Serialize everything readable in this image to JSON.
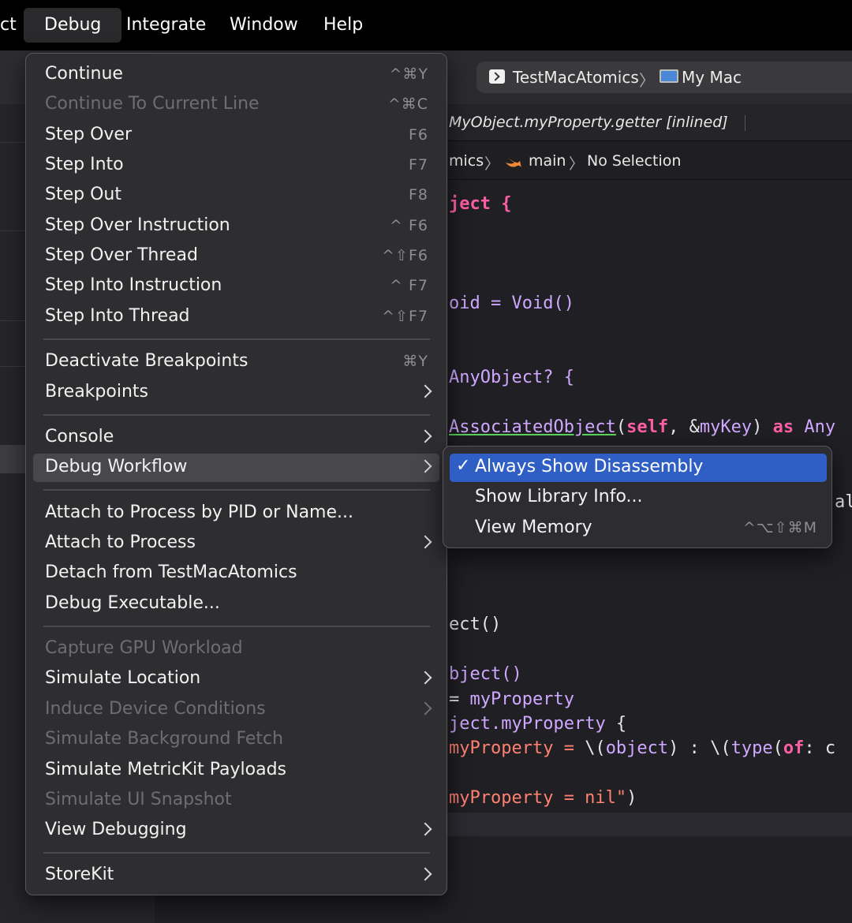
{
  "menubar": {
    "items": [
      "ct",
      "Debug",
      "Integrate",
      "Window",
      "Help"
    ],
    "active_index": 1
  },
  "toolbar": {
    "scheme": "TestMacAtomics",
    "destination": "My Mac"
  },
  "debug_bar": {
    "stack_frame": "MyObject.myProperty.getter [inlined]"
  },
  "jump_bar": {
    "file_fragment": "mics",
    "symbol": "main",
    "selection": "No Selection"
  },
  "code_lines": [
    [
      "ject {"
    ],
    [
      "oid = Void()"
    ],
    [
      "AnyObject? {"
    ],
    [
      "AssociatedObject",
      "(",
      "self",
      ", &",
      "myKey",
      ") ",
      "as",
      " Any"
    ],
    [
      "al"
    ],
    [
      "ect()"
    ],
    [
      "bject()"
    ],
    [
      "= ",
      "myProperty"
    ],
    [
      "ject.",
      "myProperty",
      " {"
    ],
    [
      "myProperty = ",
      "\\(",
      "object",
      ") : \\(",
      "type",
      "(",
      "of",
      ": c"
    ],
    [
      "myProperty = nil\"",
      ")"
    ]
  ],
  "debug_menu": {
    "items": [
      {
        "label": "Continue",
        "shortcut": "^⌘Y"
      },
      {
        "label": "Continue To Current Line",
        "shortcut": "^⌘C"
      },
      {
        "label": "Step Over",
        "shortcut": "F6"
      },
      {
        "label": "Step Into",
        "shortcut": "F7"
      },
      {
        "label": "Step Out",
        "shortcut": "F8"
      },
      {
        "label": "Step Over Instruction",
        "shortcut": "^ F6"
      },
      {
        "label": "Step Over Thread",
        "shortcut": "^⇧F6"
      },
      {
        "label": "Step Into Instruction",
        "shortcut": "^ F7"
      },
      {
        "label": "Step Into Thread",
        "shortcut": "^⇧F7"
      },
      {
        "label": "Deactivate Breakpoints",
        "shortcut": "⌘Y"
      },
      {
        "label": "Breakpoints"
      },
      {
        "label": "Console"
      },
      {
        "label": "Debug Workflow"
      },
      {
        "label": "Attach to Process by PID or Name..."
      },
      {
        "label": "Attach to Process"
      },
      {
        "label": "Detach from TestMacAtomics"
      },
      {
        "label": "Debug Executable..."
      },
      {
        "label": "Capture GPU Workload"
      },
      {
        "label": "Simulate Location"
      },
      {
        "label": "Induce Device Conditions"
      },
      {
        "label": "Simulate Background Fetch"
      },
      {
        "label": "Simulate MetricKit Payloads"
      },
      {
        "label": "Simulate UI Snapshot"
      },
      {
        "label": "View Debugging"
      },
      {
        "label": "StoreKit"
      }
    ]
  },
  "debug_workflow_submenu": {
    "items": [
      {
        "label": "Always Show Disassembly",
        "check": "✓"
      },
      {
        "label": "Show Library Info..."
      },
      {
        "label": "View Memory",
        "shortcut": "^⌥⇧⌘M"
      }
    ]
  }
}
